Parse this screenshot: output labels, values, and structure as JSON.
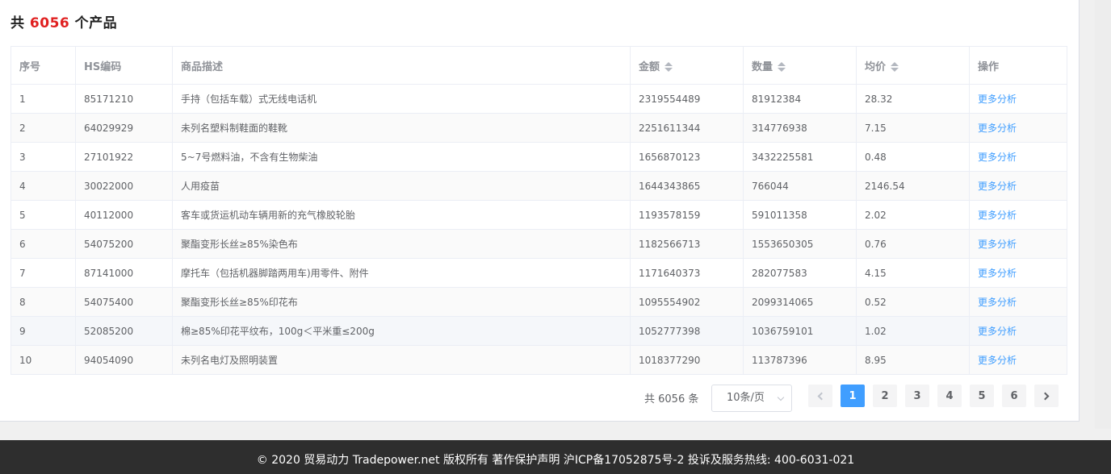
{
  "heading": {
    "prefix": "共",
    "count": "6056",
    "suffix": "个产品"
  },
  "table": {
    "columns": [
      "序号",
      "HS编码",
      "商品描述",
      "金额",
      "数量",
      "均价",
      "操作"
    ],
    "rows": [
      [
        "1",
        "85171210",
        "手持（包括车载）式无线电话机",
        "2319554489",
        "81912384",
        "28.32",
        "更多分析"
      ],
      [
        "2",
        "64029929",
        "未列名塑料制鞋面的鞋靴",
        "2251611344",
        "314776938",
        "7.15",
        "更多分析"
      ],
      [
        "3",
        "27101922",
        "5~7号燃料油，不含有生物柴油",
        "1656870123",
        "3432225581",
        "0.48",
        "更多分析"
      ],
      [
        "4",
        "30022000",
        "人用疫苗",
        "1644343865",
        "766044",
        "2146.54",
        "更多分析"
      ],
      [
        "5",
        "40112000",
        "客车或货运机动车辆用新的充气橡胶轮胎",
        "1193578159",
        "591011358",
        "2.02",
        "更多分析"
      ],
      [
        "6",
        "54075200",
        "聚酯变形长丝≥85%染色布",
        "1182566713",
        "1553650305",
        "0.76",
        "更多分析"
      ],
      [
        "7",
        "87141000",
        "摩托车（包括机器脚踏两用车)用零件、附件",
        "1171640373",
        "282077583",
        "4.15",
        "更多分析"
      ],
      [
        "8",
        "54075400",
        "聚酯变形长丝≥85%印花布",
        "1095554902",
        "2099314065",
        "0.52",
        "更多分析"
      ],
      [
        "9",
        "52085200",
        "棉≥85%印花平纹布，100g＜平米重≤200g",
        "1052777398",
        "1036759101",
        "1.02",
        "更多分析"
      ],
      [
        "10",
        "94054090",
        "未列名电灯及照明装置",
        "1018377290",
        "113787396",
        "8.95",
        "更多分析"
      ]
    ]
  },
  "pagination": {
    "total_text": "共 6056 条",
    "page_size": "10条/页",
    "pages": [
      "1",
      "2",
      "3",
      "4",
      "5",
      "6"
    ],
    "current": "1"
  },
  "footer": {
    "text": "© 2020 贸易动力 Tradepower.net 版权所有 著作保护声明 沪ICP备17052875号-2 投诉及服务热线: 400-6031-021"
  },
  "colors": {
    "accent": "#409eff",
    "count": "#e02020",
    "footer_bg": "#2e2e2e"
  },
  "icons": {
    "sort": "sort-caret-icon",
    "prev": "chevron-left-icon",
    "next": "chevron-right-icon",
    "select": "chevron-down-icon"
  }
}
